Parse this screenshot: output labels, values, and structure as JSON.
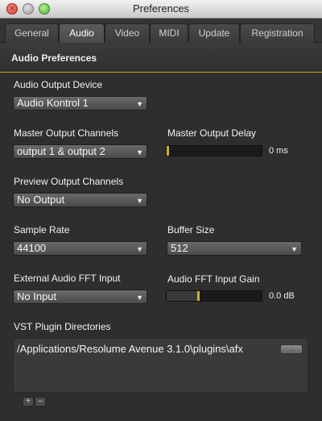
{
  "window": {
    "title": "Preferences"
  },
  "tabs": [
    {
      "label": "General"
    },
    {
      "label": "Audio",
      "active": true
    },
    {
      "label": "Video"
    },
    {
      "label": "MIDI"
    },
    {
      "label": "Update"
    },
    {
      "label": "Registration"
    }
  ],
  "section": {
    "title": "Audio Preferences",
    "accent_color": "#c9a52a"
  },
  "audio_output_device": {
    "label": "Audio Output Device",
    "value": "Audio Kontrol 1"
  },
  "master_output_channels": {
    "label": "Master Output Channels",
    "value": "output 1 & output 2"
  },
  "master_output_delay": {
    "label": "Master Output Delay",
    "value_text": "0 ms",
    "level": 0.0
  },
  "preview_output_channels": {
    "label": "Preview Output Channels",
    "value": "No Output"
  },
  "sample_rate": {
    "label": "Sample Rate",
    "value": "44100"
  },
  "buffer_size": {
    "label": "Buffer Size",
    "value": "512"
  },
  "external_fft_input": {
    "label": "External Audio FFT Input",
    "value": "No Input"
  },
  "fft_input_gain": {
    "label": "Audio FFT Input Gain",
    "value_text": "0.0 dB",
    "level": 0.33
  },
  "vst": {
    "label": "VST Plugin Directories",
    "path": "/Applications/Resolume Avenue 3.1.0\\plugins\\afx",
    "browse_label": "...",
    "add_label": "+",
    "remove_label": "–"
  },
  "icons": {
    "close": "close-icon",
    "minimize": "minimize-icon",
    "maximize": "zoom-icon",
    "dropdown_arrow": "chevron-down-icon"
  }
}
